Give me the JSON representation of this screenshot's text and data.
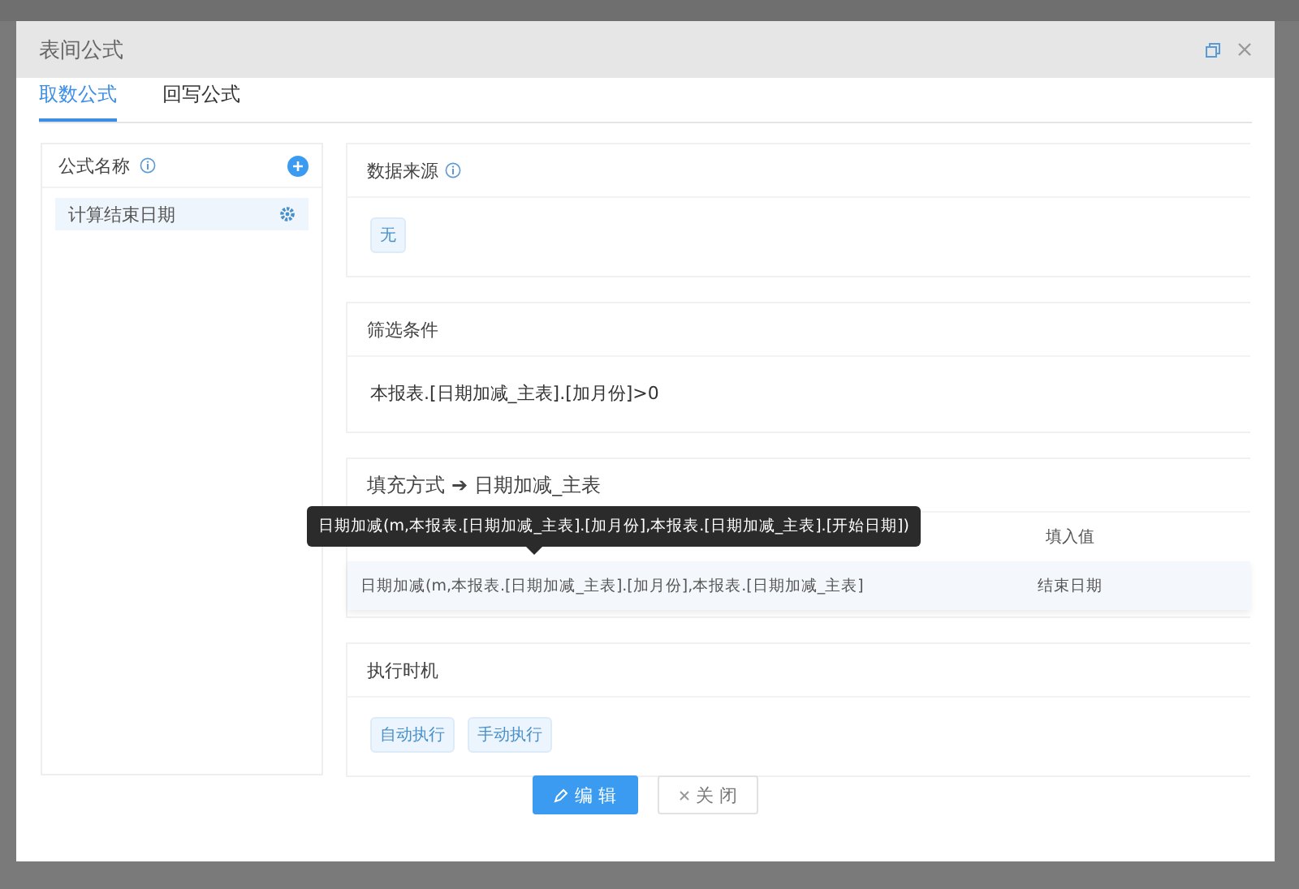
{
  "dialog": {
    "title": "表间公式"
  },
  "tabs": [
    {
      "label": "取数公式",
      "selected": true
    },
    {
      "label": "回写公式",
      "selected": false
    }
  ],
  "formula_list": {
    "title": "公式名称",
    "items": [
      {
        "label": "计算结束日期",
        "selected": true
      }
    ]
  },
  "data_source": {
    "title": "数据来源",
    "tags": [
      "无"
    ]
  },
  "filter": {
    "title": "筛选条件",
    "expression": "本报表.[日期加减_主表].[加月份]>0"
  },
  "fill": {
    "title": "填充方式",
    "arrow": "➔",
    "target": "日期加减_主表",
    "columns": [
      "",
      "填入值"
    ],
    "rows": [
      {
        "cells": [
          "日期加减(m,本报表.[日期加减_主表].[加月份],本报表.[日期加减_主表]",
          "结束日期"
        ]
      }
    ],
    "tooltip": "日期加减(m,本报表.[日期加减_主表].[加月份],本报表.[日期加减_主表].[开始日期])"
  },
  "timing": {
    "title": "执行时机",
    "tags": [
      "自动执行",
      "手动执行"
    ]
  },
  "buttons": [
    {
      "label": "编 辑",
      "kind": "primary"
    },
    {
      "label": "关 闭",
      "kind": "default"
    }
  ]
}
